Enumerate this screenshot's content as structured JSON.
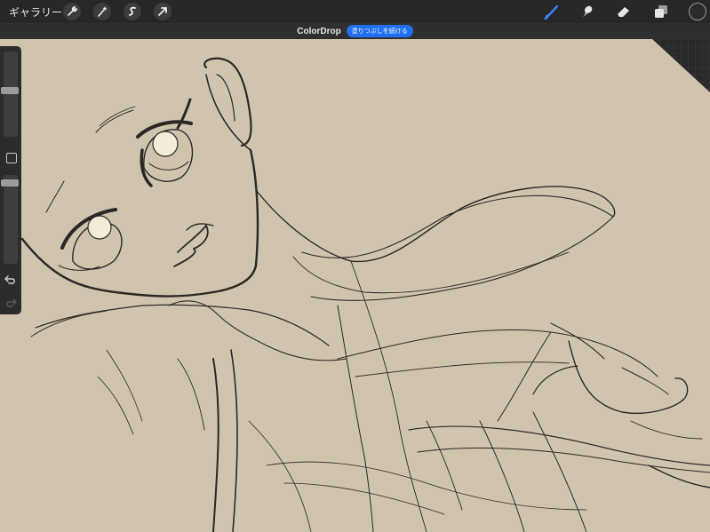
{
  "topbar": {
    "gallery_label": "ギャラリー",
    "left_tools": [
      "wrench-icon",
      "magic-wand-icon",
      "selection-icon",
      "transform-arrow-icon"
    ],
    "right_tools": [
      "brush-icon",
      "smudge-icon",
      "eraser-icon",
      "layers-icon",
      "color-picker-dot"
    ],
    "active_tool_color": "#3b82f6",
    "current_color": "#2b2b2b"
  },
  "colordrop": {
    "label": "ColorDrop",
    "continue_fill_button": "塗りつぶしを続ける",
    "button_color": "#1f6ff0"
  },
  "sidebar": {
    "brush_size_level": 0.55,
    "opacity_level": 0.95,
    "modifier_icon": "square-modifier-icon",
    "undo_icon": "undo-icon",
    "redo_icon": "redo-icon"
  },
  "canvas": {
    "background_color": "#d1c4ae",
    "stroke_color": "#2a2826"
  }
}
